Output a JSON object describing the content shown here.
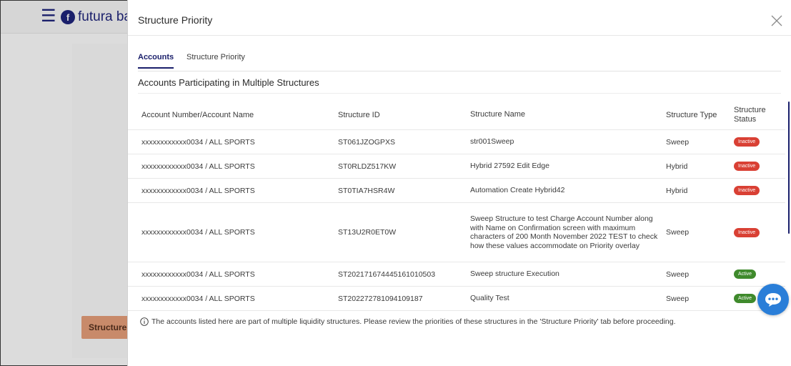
{
  "background": {
    "logo_text": "futura bar",
    "button_label": "Structure Pr"
  },
  "modal": {
    "title": "Structure Priority",
    "tabs": [
      {
        "label": "Accounts",
        "active": true
      },
      {
        "label": "Structure Priority",
        "active": false
      }
    ],
    "section_title": "Accounts Participating in Multiple Structures",
    "table": {
      "headers": {
        "account": "Account Number/Account Name",
        "structure_id": "Structure ID",
        "structure_name": "Structure Name",
        "structure_type": "Structure Type",
        "status_line1": "Structure",
        "status_line2": "Status"
      },
      "rows": [
        {
          "account": "xxxxxxxxxxxx0034 / ALL SPORTS",
          "structure_id": "ST061JZOGPXS",
          "structure_name": "str001Sweep",
          "structure_type": "Sweep",
          "status": "Inactive"
        },
        {
          "account": "xxxxxxxxxxxx0034 / ALL SPORTS",
          "structure_id": "ST0RLDZ517KW",
          "structure_name": "Hybrid 27592 Edit Edge",
          "structure_type": "Hybrid",
          "status": "Inactive"
        },
        {
          "account": "xxxxxxxxxxxx0034 / ALL SPORTS",
          "structure_id": "ST0TIA7HSR4W",
          "structure_name": "Automation Create Hybrid42",
          "structure_type": "Hybrid",
          "status": "Inactive"
        },
        {
          "account": "xxxxxxxxxxxx0034 / ALL SPORTS",
          "structure_id": "ST13U2R0ET0W",
          "structure_name": "Sweep Structure to test Charge Account Number along with Name on Confirmation screen with maximum characters of 200 Month November 2022 TEST to check how these values accommodate on Priority overlay",
          "structure_type": "Sweep",
          "status": "Inactive"
        },
        {
          "account": "xxxxxxxxxxxx0034 / ALL SPORTS",
          "structure_id": "ST202171674445161010503",
          "structure_name": "Sweep structure Execution",
          "structure_type": "Sweep",
          "status": "Active"
        },
        {
          "account": "xxxxxxxxxxxx0034 / ALL SPORTS",
          "structure_id": "ST202272781094109187",
          "structure_name": "Quality Test",
          "structure_type": "Sweep",
          "status": "Active"
        }
      ]
    },
    "info_text": "The accounts listed here are part of multiple liquidity structures. Please review the priorities of these structures in the 'Structure Priority' tab before proceeding."
  },
  "colors": {
    "brand": "#1a1f6b",
    "inactive": "#d94034",
    "active": "#3f8a2c",
    "chat": "#2a7ed8"
  }
}
